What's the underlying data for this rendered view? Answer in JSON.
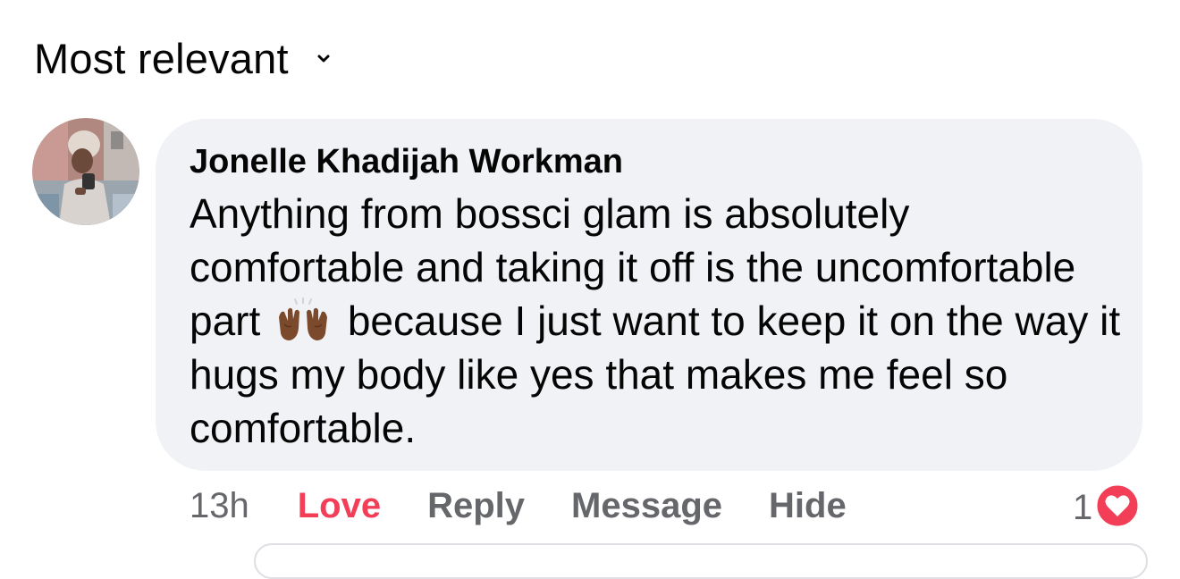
{
  "sort": {
    "label": "Most relevant",
    "chevron_icon": "chevron-down-icon"
  },
  "comment": {
    "avatar_icon": "profile-photo",
    "author": "Jonelle Khadijah Workman",
    "text_before_emoji": "Anything from bossci glam is absolutely comfortable and taking it off is the uncomfortable part",
    "emoji": "raising-hands-emoji",
    "text_after_emoji": "because I just want to keep it on the way it hugs my body like yes that makes me feel so comfortable.",
    "bubble_color": "#f0f2f5",
    "actions": {
      "time": "13h",
      "love": "Love",
      "reply": "Reply",
      "message": "Message",
      "hide": "Hide"
    },
    "reactions": {
      "count": "1",
      "icon": "heart-reaction-icon",
      "color": "#f33e58"
    }
  }
}
